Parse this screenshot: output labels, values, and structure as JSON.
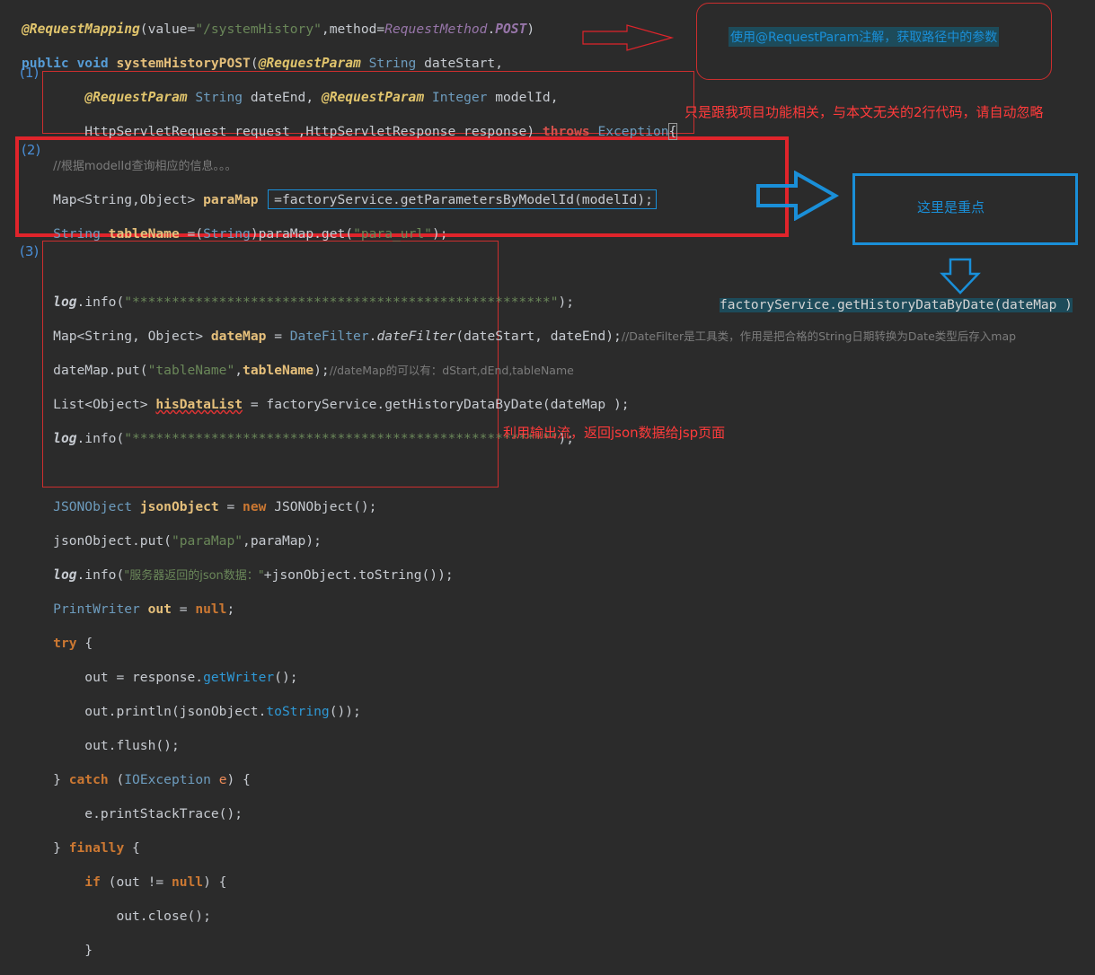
{
  "code": {
    "l1": {
      "a": "@RequestMapping",
      "b": "(value=",
      "c": "\"/systemHistory\"",
      "d": ",method=",
      "e": "RequestMethod",
      "f": ".",
      "g": "POST",
      "h": ")"
    },
    "l2": {
      "a": "public void ",
      "b": "systemHistoryPOST",
      "c": "(",
      "d": "@RequestParam ",
      "e": "String ",
      "f": "dateStart,"
    },
    "l3": {
      "a": "@RequestParam ",
      "b": "String ",
      "c": "dateEnd, ",
      "d": "@RequestParam ",
      "e": "Integer ",
      "f": "modelId,"
    },
    "l4": {
      "a": "HttpServletRequest ",
      "b": "request ,",
      "c": "HttpServletResponse ",
      "d": "response) ",
      "e": "throws ",
      "f": "Exception",
      "g": "{"
    },
    "l5": "//根据modelId查询相应的信息。。。",
    "l6": {
      "a": "Map<String,Object> ",
      "b": "paraMap",
      "c": "  =factoryService.getParametersByModelId(modelId);"
    },
    "l7": {
      "a": "String ",
      "b": "tableName ",
      "c": "=(",
      "d": "String",
      "e": ")paraMap.get(",
      "f": "\"para_url\"",
      "g": ");"
    },
    "l8": {
      "a": "log",
      "b": ".info(",
      "c": "\"*****************************************************\"",
      "d": ");"
    },
    "l9": {
      "a": "Map<String, Object> ",
      "b": "dateMap ",
      "c": "= ",
      "d": "DateFilter",
      "e": ".",
      "f": "dateFilter",
      "g": "(dateStart, dateEnd);",
      "h": "//DateFilter是工具类，作用是把合格的String日期转换为Date类型后存入map"
    },
    "l10": {
      "a": "dateMap.put(",
      "b": "\"tableName\"",
      "c": ",",
      "d": "tableName",
      "e": ");",
      "f": "//dateMap的可以有：dStart,dEnd,tableName"
    },
    "l11": {
      "a": "List<Object> ",
      "b": "hisDataList",
      "c": " = ",
      "d": "factoryService.getHistoryDataByDate(dateMap );"
    },
    "l12": {
      "a": "log",
      "b": ".info(",
      "c": "\"*****************************************************\"",
      "d": ");"
    },
    "l13": {
      "a": "JSONObject ",
      "b": "jsonObject ",
      "c": "= ",
      "d": "new ",
      "e": "JSONObject();"
    },
    "l14": {
      "a": "jsonObject.put(",
      "b": "\"paraMap\"",
      "c": ",paraMap);"
    },
    "l15": {
      "a": "log",
      "b": ".info(",
      "c": "\"服务器返回的json数据：\"",
      "d": "+jsonObject.toString());"
    },
    "l16": {
      "a": "PrintWriter ",
      "b": "out ",
      "c": "= ",
      "d": "null",
      "e": ";"
    },
    "l17": {
      "a": "try ",
      "b": "{"
    },
    "l18": {
      "a": "out = response.",
      "b": "getWriter",
      "c": "();"
    },
    "l19": {
      "a": "out.println(jsonObject.",
      "b": "toString",
      "c": "());"
    },
    "l20": {
      "a": "out.flush();"
    },
    "l21": {
      "a": "} ",
      "b": "catch ",
      "c": "(",
      "d": "IOException ",
      "e": "e",
      "f": ") {"
    },
    "l22": {
      "a": "e.printStackTrace();"
    },
    "l23": {
      "a": "} ",
      "b": "finally ",
      "c": "{"
    },
    "l24": {
      "a": "if ",
      "b": "(out != ",
      "c": "null",
      "d": ") {"
    },
    "l25": {
      "a": "out.close();"
    },
    "l26": {
      "a": "}"
    }
  },
  "annotations": {
    "note1": "使用@RequestParam注解，获取路径中的参数",
    "note2": "只是跟我项目功能相关，与本文无关的2行代码，请自动忽略",
    "note3": "这里是重点",
    "note4": "factoryService.getHistoryDataByDate(dateMap )",
    "note5": "利用输出流，返回json数据给jsp页面",
    "marker1": "(1)",
    "marker2": "(2)",
    "marker3": "(3)"
  },
  "colors": {
    "red": "#e0242b",
    "blue": "#1a8fd8",
    "text_red": "#ff3b3b"
  }
}
